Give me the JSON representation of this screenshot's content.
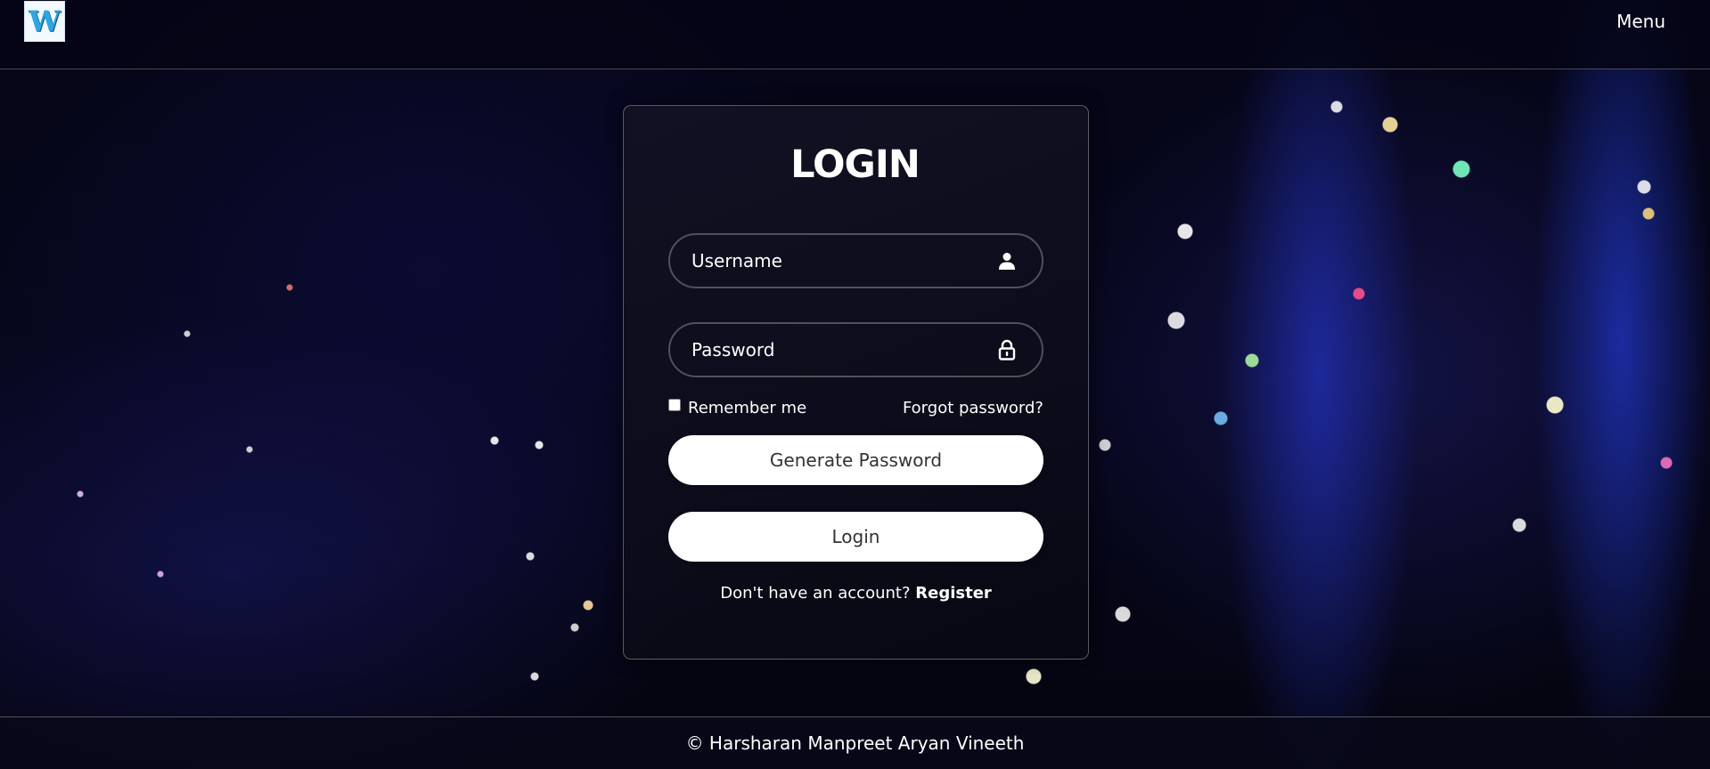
{
  "header": {
    "logo_letter": "W",
    "menu_label": "Menu"
  },
  "login_form": {
    "title": "LOGIN",
    "username": {
      "placeholder": "Username",
      "value": "",
      "icon": "user-icon"
    },
    "password": {
      "placeholder": "Password",
      "value": "",
      "icon": "lock-icon"
    },
    "remember_me": {
      "label": "Remember me",
      "checked": false
    },
    "forgot_password_label": "Forgot password?",
    "generate_password_label": "Generate Password",
    "login_button_label": "Login",
    "register_prompt": "Don't have an account?",
    "register_link_label": "Register"
  },
  "footer": {
    "copyright": "© Harsharan Manpreet Aryan Vineeth"
  },
  "colors": {
    "background": "#03030f",
    "button_bg": "#ffffff",
    "button_text": "#333333",
    "accent_blue": "#2aa7e6"
  }
}
